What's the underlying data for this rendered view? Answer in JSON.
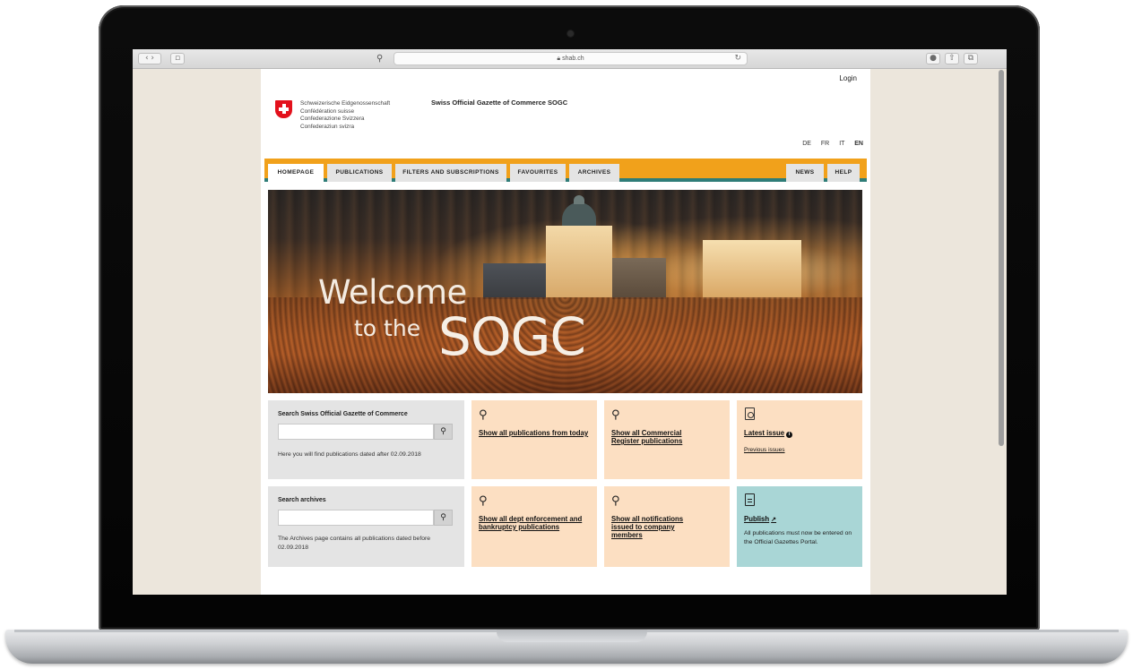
{
  "browser": {
    "address": "shab.ch",
    "address_icon": "lock-icon",
    "reload_icon": "reload-icon"
  },
  "page": {
    "login": "Login",
    "confederation": [
      "Schweizerische Eidgenossenschaft",
      "Confédération suisse",
      "Confederazione Svizzera",
      "Confederaziun svizra"
    ],
    "site_title": "Swiss Official Gazette of Commerce SOGC",
    "languages": [
      "DE",
      "FR",
      "IT",
      "EN"
    ],
    "active_language": "EN",
    "nav": {
      "left": [
        "HOMEPAGE",
        "PUBLICATIONS",
        "FILTERS AND SUBSCRIPTIONS",
        "FAVOURITES",
        "ARCHIVES"
      ],
      "right": [
        "NEWS",
        "HELP"
      ],
      "active": "HOMEPAGE"
    },
    "hero": {
      "line1": "Welcome",
      "line2": "to the",
      "line3": "SOGC"
    },
    "search_sogc": {
      "label": "Search Swiss Official Gazette of Commerce",
      "hint": "Here you will find publications dated after 02.09.2018"
    },
    "search_archives": {
      "label": "Search archives",
      "hint": "The Archives page contains all publications dated before 02.09.2018"
    },
    "cards": {
      "today": "Show all publications from today",
      "commercial": "Show all Commercial Register publications",
      "latest_issue": "Latest issue",
      "previous_issues": "Previous issues",
      "debt": "Show all dept enforcement and bankruptcy publications",
      "notifications": "Show all notifications issued to company members",
      "publish": "Publish",
      "publish_text": "All publications must now be entered on the Official Gazettes Portal."
    }
  },
  "colors": {
    "nav_orange": "#f1a11b",
    "nav_teal": "#2f7d78",
    "card_peach": "#fcdfc2",
    "card_teal": "#a9d6d6",
    "card_grey": "#e4e4e4",
    "swiss_red": "#e3111c"
  }
}
